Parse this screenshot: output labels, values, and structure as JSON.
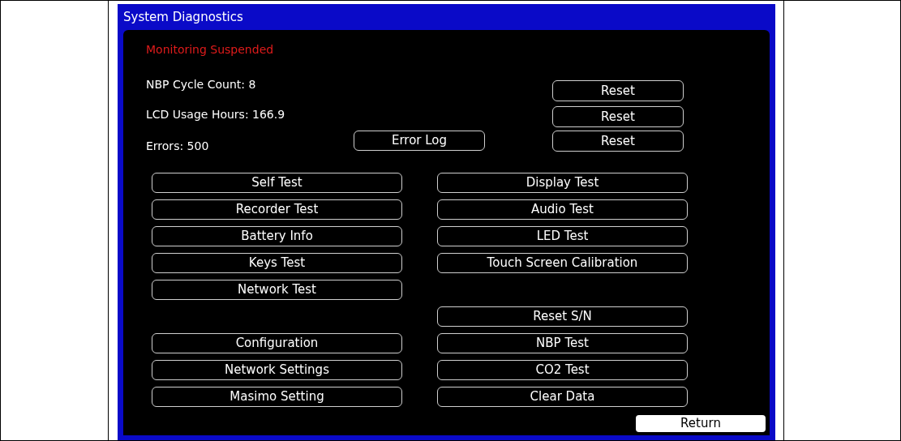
{
  "window": {
    "title": "System Diagnostics"
  },
  "status": "Monitoring Suspended",
  "counters": [
    {
      "label": "NBP Cycle Count: 8",
      "reset": "Reset"
    },
    {
      "label": "LCD Usage Hours: 166.9",
      "reset": "Reset"
    },
    {
      "label": "Errors: 500",
      "action": "Error Log",
      "reset": "Reset"
    }
  ],
  "rows": [
    {
      "left": "Self Test",
      "right": "Display Test"
    },
    {
      "left": "Recorder Test",
      "right": "Audio Test"
    },
    {
      "left": "Battery Info",
      "right": "LED Test"
    },
    {
      "left": "Keys Test",
      "right": "Touch Screen Calibration"
    },
    {
      "left": "Network Test"
    },
    {
      "right": "Reset S/N"
    },
    {
      "left": "Configuration",
      "right": "NBP Test"
    },
    {
      "left": "Network Settings",
      "right": "CO2 Test"
    },
    {
      "left": "Masimo Setting",
      "right": "Clear Data"
    }
  ],
  "return_button": {
    "label": "Return",
    "focused": true
  }
}
